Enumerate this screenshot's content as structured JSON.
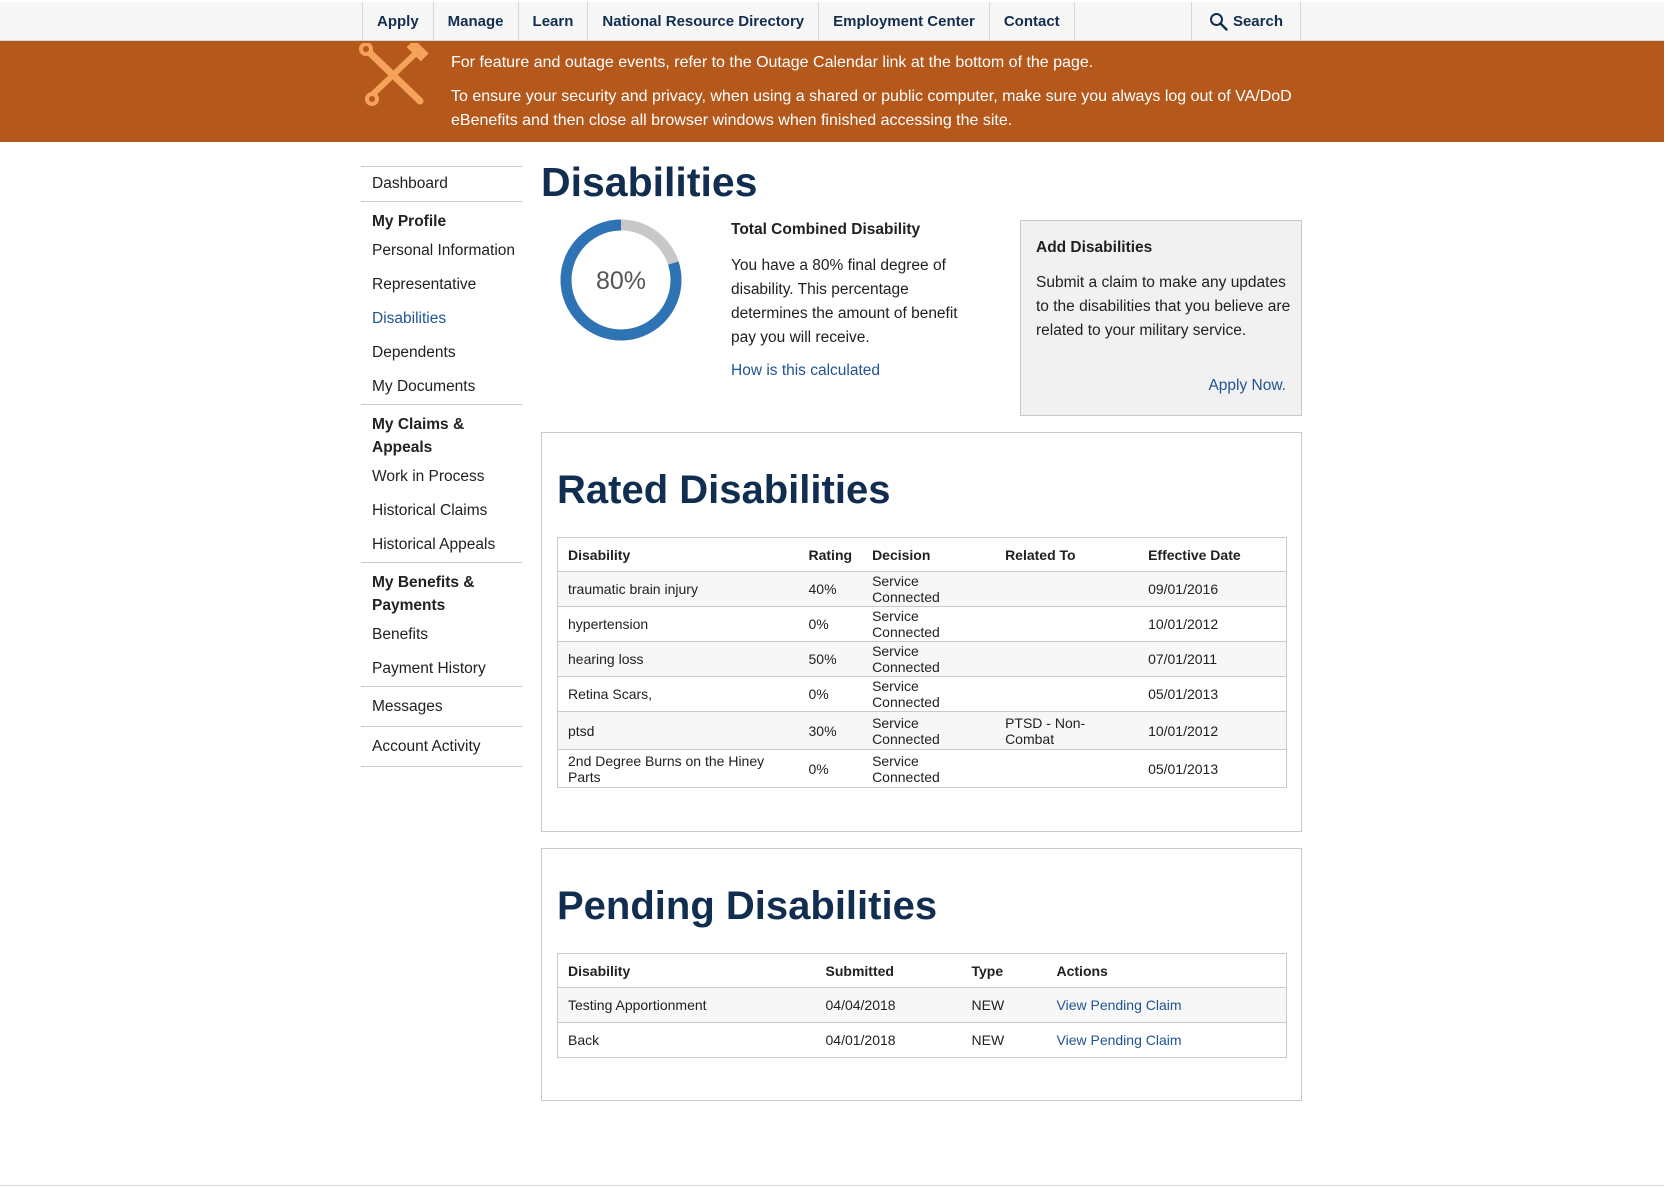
{
  "topnav": {
    "items": [
      "Apply",
      "Manage",
      "Learn",
      "National Resource Directory",
      "Employment Center",
      "Contact"
    ],
    "search_label": "Search"
  },
  "banner": {
    "line1": "For feature and outage events, refer to the Outage Calendar link at the bottom of the page.",
    "line2": "To ensure your security and privacy, when using a shared or public computer, make sure you always log out of VA/DoD eBenefits and then close all browser windows when finished accessing the site.",
    "icon": "tools-icon",
    "color": "#b5581c"
  },
  "sidebar": {
    "dashboard": "Dashboard",
    "profile_heading": "My Profile",
    "personal_information": "Personal Information",
    "representative": "Representative",
    "disabilities": "Disabilities",
    "dependents": "Dependents",
    "my_documents": "My Documents",
    "claims_heading": "My Claims & Appeals",
    "work_in_process": "Work in Process",
    "historical_claims": "Historical Claims",
    "historical_appeals": "Historical Appeals",
    "benefits_heading": "My Benefits & Payments",
    "benefits": "Benefits",
    "payment_history": "Payment History",
    "messages": "Messages",
    "account_activity": "Account Activity",
    "active_color": "#205493"
  },
  "page": {
    "title": "Disabilities"
  },
  "combined": {
    "percent_value": 80,
    "percent_label": "80%",
    "title": "Total Combined Disability",
    "text": "You have a 80% final degree of disability. This percentage determines the amount of benefit pay you will receive.",
    "link": "How is this calculated",
    "ring_color": "#2e74b5",
    "ring_remainder_color": "#c8c8c8"
  },
  "add_box": {
    "title": "Add Disabilities",
    "text": "Submit a claim to make any updates to the disabilities that you believe are related to your military service.",
    "link": "Apply Now."
  },
  "rated": {
    "title": "Rated Disabilities",
    "headers": {
      "disability": "Disability",
      "rating": "Rating",
      "decision": "Decision",
      "related_to": "Related To",
      "effective_date": "Effective Date"
    },
    "rows": [
      {
        "disability": "traumatic brain injury",
        "rating": "40%",
        "decision": "Service Connected",
        "related_to": "",
        "effective_date": "09/01/2016"
      },
      {
        "disability": "hypertension",
        "rating": "0%",
        "decision": "Service Connected",
        "related_to": "",
        "effective_date": "10/01/2012"
      },
      {
        "disability": "hearing loss",
        "rating": "50%",
        "decision": "Service Connected",
        "related_to": "",
        "effective_date": "07/01/2011"
      },
      {
        "disability": "Retina Scars,",
        "rating": "0%",
        "decision": "Service Connected",
        "related_to": "",
        "effective_date": "05/01/2013"
      },
      {
        "disability": "ptsd",
        "rating": "30%",
        "decision": "Service Connected",
        "related_to": "PTSD - Non-Combat",
        "effective_date": "10/01/2012"
      },
      {
        "disability": "2nd Degree Burns on the Hiney Parts",
        "rating": "0%",
        "decision": "Service Connected",
        "related_to": "",
        "effective_date": "05/01/2013"
      }
    ]
  },
  "pending": {
    "title": "Pending Disabilities",
    "headers": {
      "disability": "Disability",
      "submitted": "Submitted",
      "type": "Type",
      "actions": "Actions"
    },
    "rows": [
      {
        "disability": "Testing Apportionment",
        "submitted": "04/04/2018",
        "type": "NEW",
        "action": "View Pending Claim"
      },
      {
        "disability": "Back",
        "submitted": "04/01/2018",
        "type": "NEW",
        "action": "View Pending Claim"
      }
    ]
  }
}
